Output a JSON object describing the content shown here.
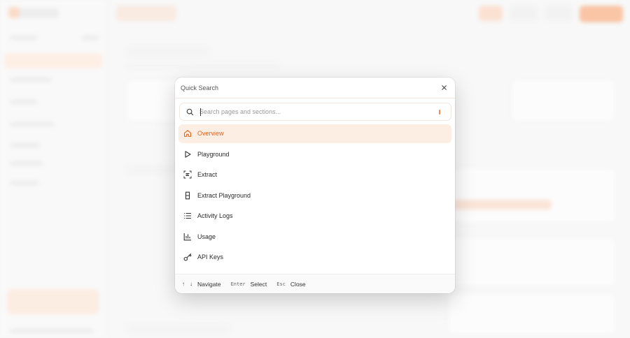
{
  "theme": {
    "accent": "#e2631a",
    "accent_bg": "#fdeee4"
  },
  "modal": {
    "title": "Quick Search",
    "close_icon": "close-icon",
    "search": {
      "placeholder": "Search pages and sections...",
      "value": "",
      "icon": "search-icon"
    },
    "items": [
      {
        "label": "Overview",
        "icon": "home-icon",
        "active": true
      },
      {
        "label": "Playground",
        "icon": "play-icon",
        "active": false
      },
      {
        "label": "Extract",
        "icon": "scan-text-icon",
        "active": false
      },
      {
        "label": "Extract Playground",
        "icon": "flask-icon",
        "active": false
      },
      {
        "label": "Activity Logs",
        "icon": "list-icon",
        "active": false
      },
      {
        "label": "Usage",
        "icon": "bar-chart-icon",
        "active": false
      },
      {
        "label": "API Keys",
        "icon": "key-icon",
        "active": false
      }
    ],
    "footer": {
      "up_arrow": "↑",
      "down_arrow": "↓",
      "navigate_label": "Navigate",
      "enter_key": "Enter",
      "select_label": "Select",
      "esc_key": "Esc",
      "close_label": "Close"
    }
  }
}
